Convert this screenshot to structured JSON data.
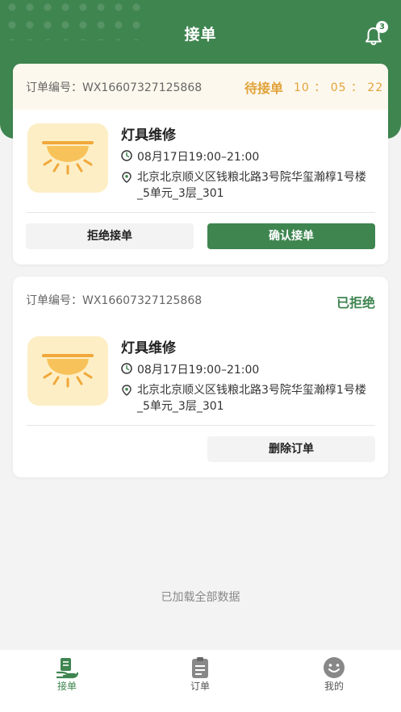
{
  "header": {
    "title": "接单",
    "notification_count": "3"
  },
  "orders": [
    {
      "order_no": "订单编号：WX16607327125868",
      "status": "待接单",
      "countdown": "10 ： 05 ： 22",
      "service": "灯具维修",
      "time": "08月17日19:00–21:00",
      "address": "北京北京顺义区钱粮北路3号院华玺瀚椁1号楼_5单元_3层_301",
      "buttons": {
        "reject": "拒绝接单",
        "confirm": "确认接单"
      }
    },
    {
      "order_no": "订单编号：WX16607327125868",
      "status": "已拒绝",
      "service": "灯具维修",
      "time": "08月17日19:00–21:00",
      "address": "北京北京顺义区钱粮北路3号院华玺瀚椁1号楼_5单元_3层_301",
      "buttons": {
        "delete": "删除订单"
      }
    }
  ],
  "footer_text": "已加载全部数据",
  "tabbar": {
    "items": [
      {
        "label": "接单"
      },
      {
        "label": "订单"
      },
      {
        "label": "我的"
      }
    ]
  },
  "colors": {
    "primary": "#3f8550",
    "pending": "#e0a33a",
    "thumb_bg": "#fdeec5"
  }
}
